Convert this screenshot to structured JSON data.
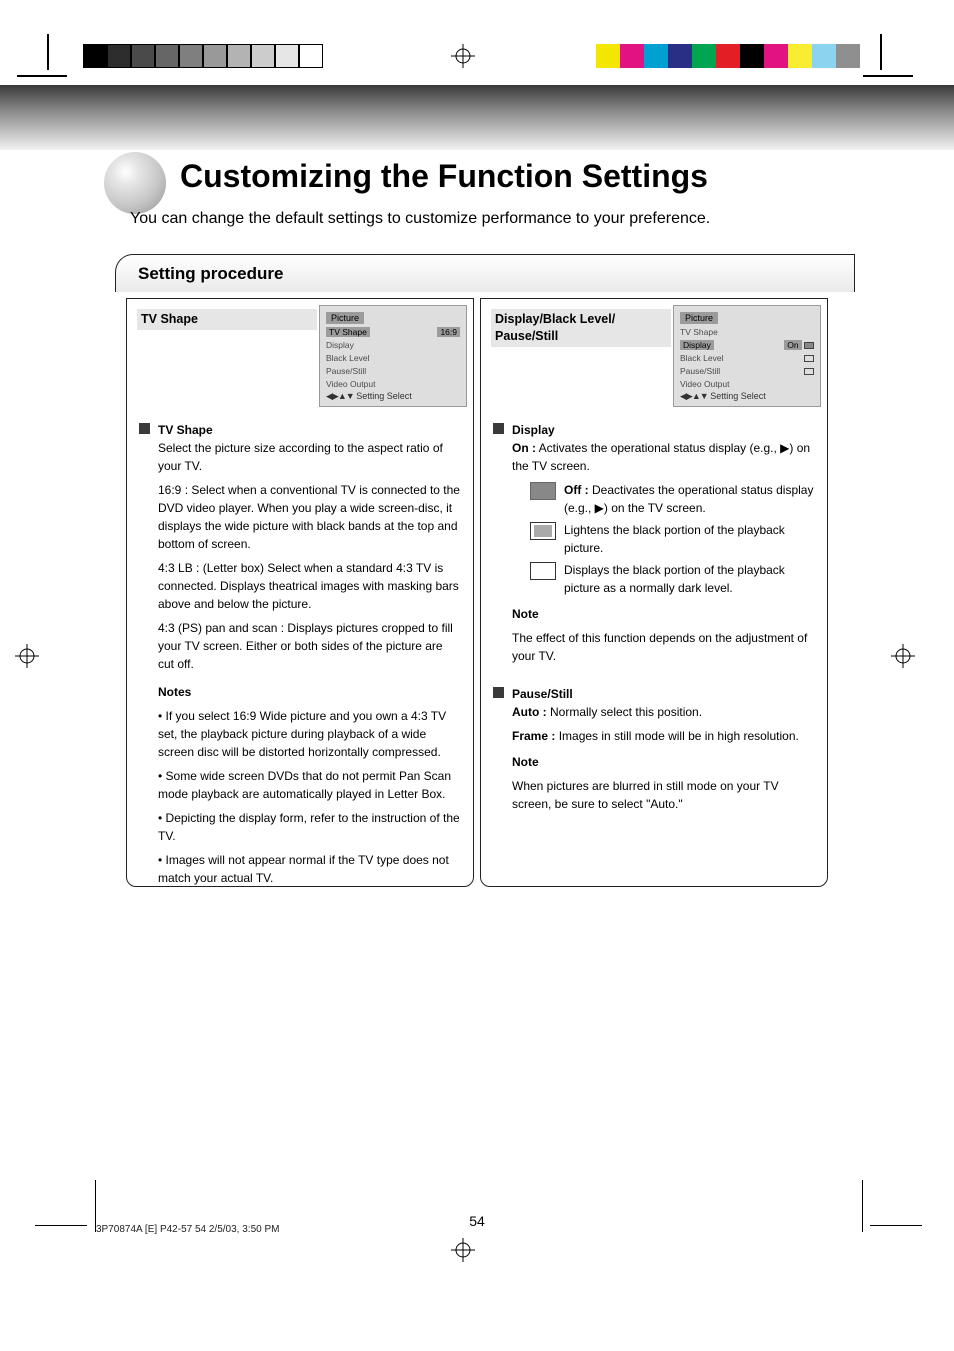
{
  "page": {
    "title": "Customizing the Function Settings",
    "subtitle": "You can change the default settings to customize performance to your preference.",
    "section_tab": "Setting procedure",
    "page_number": "54",
    "footer": "3P70874A [E] P42-57    54    2/5/03, 3:50 PM"
  },
  "panel_left": {
    "heading": "TV Shape",
    "menu": {
      "title": "Picture",
      "items": [
        {
          "label": "TV Shape",
          "left_hl": true,
          "value": "16:9",
          "value_hl": true
        },
        {
          "label": "Display",
          "value": ""
        },
        {
          "label": "Black Level",
          "value": ""
        },
        {
          "label": "Pause/Still",
          "value": ""
        },
        {
          "label": "Video Output",
          "value": ""
        }
      ],
      "nav": "Setting    Select"
    },
    "item_label": "TV Shape",
    "body": [
      "Select the picture size according to the aspect ratio of your TV.",
      "16:9 :   Select when a conventional TV is connected to the DVD video player. When you play a wide screen-disc, it displays the wide picture with black bands at the top and bottom of screen.",
      "4:3 LB : (Letter box)  Select when a standard 4:3 TV is connected. Displays theatrical images with masking bars above and below the picture.",
      "4:3 (PS) pan and scan : Displays pictures cropped to fill your TV screen. Either or both sides of the picture are cut off.",
      "Notes",
      "• If you select 16:9 Wide picture and you own a 4:3 TV set, the playback picture during playback of a wide screen disc will be distorted horizontally compressed.",
      "• Some wide screen DVDs that do not permit Pan Scan mode playback are automatically played in Letter Box.",
      "• Depicting the display form, refer to the instruction of the TV.",
      "• Images will not appear normal if the TV type does not match your actual TV."
    ]
  },
  "panel_right": {
    "heading": "Display/Black Level/\nPause/Still",
    "menu": {
      "title": "Picture",
      "items": [
        {
          "label": "TV Shape",
          "value": "",
          "box": "plain"
        },
        {
          "label": "Display",
          "left_hl": true,
          "value": "On",
          "value_hl": true,
          "box": "filled"
        },
        {
          "label": "Black Level",
          "value": "",
          "box": "hollow"
        },
        {
          "label": "Pause/Still",
          "value": "",
          "box": "hollow"
        },
        {
          "label": "Video Output",
          "value": ""
        }
      ],
      "nav": "Setting    Select"
    },
    "display": {
      "label": "Display",
      "opt_on": "On :",
      "opt_on_desc": "Activates the operational status display (e.g., ▶) on the TV screen.",
      "opt_off": "Off :",
      "opt_off_desc": "Deactivates the operational status display (e.g., ▶) on the TV screen.",
      "opt_dim": "      :",
      "opt_dim_desc": "Lightens the black portion of the playback picture.",
      "opt_norm": "      :",
      "opt_norm_desc": "Displays the black portion of the playback picture as a normally dark level.",
      "note": "Note",
      "note_text": "The effect of this function depends on the adjustment of your TV."
    },
    "pause": {
      "label": "Pause/Still",
      "auto": "Auto :",
      "auto_desc": "Normally select this position.",
      "frame": "Frame :",
      "frame_desc": "Images in still mode will be in high resolution.",
      "note": "Note",
      "note_text": "When pictures are blurred in still mode on your TV screen, be sure to select \"Auto.\""
    }
  },
  "colors": {
    "grays": [
      "#000000",
      "#2d2d2d",
      "#4a4a4a",
      "#666666",
      "#7f7f7f",
      "#999999",
      "#b3b3b3",
      "#cccccc",
      "#e6e6e6",
      "#ffffff"
    ],
    "hues": [
      "#f3e600",
      "#e11383",
      "#00a0d2",
      "#2a2f86",
      "#00a551",
      "#e31e24",
      "#000000",
      "#e11383",
      "#f9ed32",
      "#8bd4f0",
      "#8f8f8f"
    ]
  }
}
